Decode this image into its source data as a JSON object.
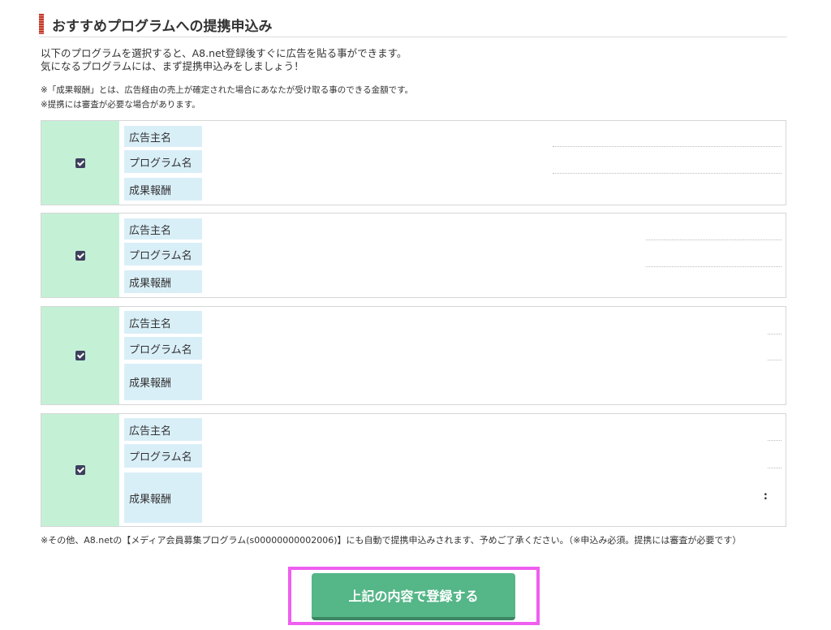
{
  "section": {
    "title": "おすすめプログラムへの提携申込み"
  },
  "intro": {
    "line1": "以下のプログラムを選択すると、A8.net登録後すぐに広告を貼る事ができます。",
    "line2": "気になるプログラムには、まず提携申込みをしましょう！"
  },
  "notes": {
    "note1": "※「成果報酬」とは、広告経由の売上が確定された場合にあなたが受け取る事のできる金額です。",
    "note2": "※提携には審査が必要な場合があります。"
  },
  "programs": [
    {
      "checked": true,
      "advertiser_label": "広告主名",
      "program_label": "プログラム名",
      "reward_label": "成果報酬"
    },
    {
      "checked": true,
      "advertiser_label": "広告主名",
      "program_label": "プログラム名",
      "reward_label": "成果報酬"
    },
    {
      "checked": true,
      "advertiser_label": "広告主名",
      "program_label": "プログラム名",
      "reward_label": "成果報酬"
    },
    {
      "checked": true,
      "advertiser_label": "広告主名",
      "program_label": "プログラム名",
      "reward_label": "成果報酬",
      "reward_value": ":"
    }
  ],
  "footnote": "※その他、A8.netの【メディア会員募集プログラム(s00000000002006)】にも自動で提携申込みされます、予めご了承ください。（※申込み必須。提携には審査が必要です）",
  "submit": {
    "label": "上記の内容で登録する"
  },
  "colors": {
    "check_bg": "#c4f1d6",
    "label_bg": "#d9eff8",
    "button": "#55b688",
    "highlight": "#f05ef0",
    "title_accent": "#c0392b"
  }
}
